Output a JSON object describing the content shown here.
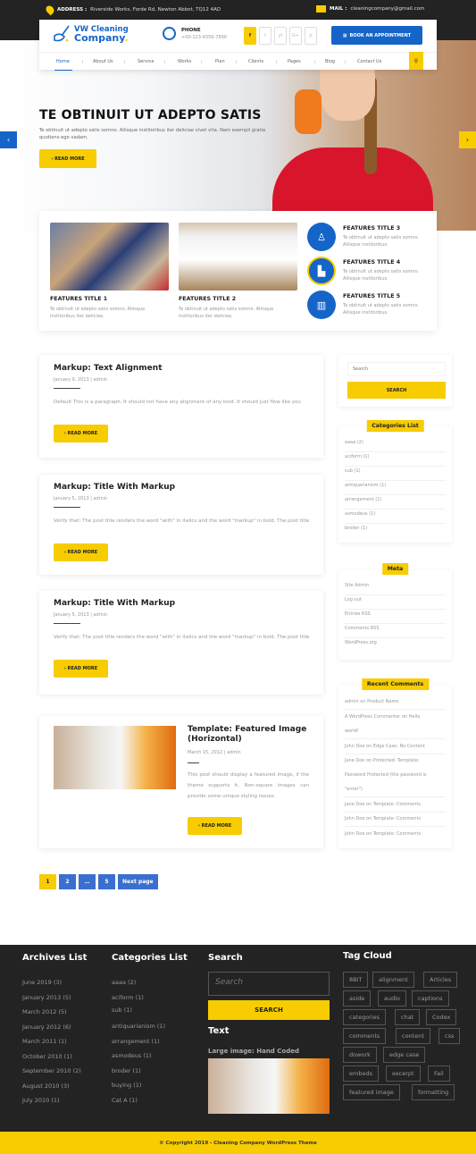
{
  "colors": {
    "primary": "#1565c8",
    "accent": "#f7cc00",
    "dark": "#232323"
  },
  "topbar": {
    "address_label": "ADDRESS :",
    "address": "Riverside Works, Forde Rd, Newton Abbot, TQ12 4AD",
    "mail_label": "MAIL :",
    "mail": "cleaningcompany@gmail.com"
  },
  "header": {
    "logo_line1": "VW Cleaning",
    "logo_line2": "Company",
    "phone_label": "PHONE",
    "phone_number": "+00-123-4356-7890",
    "socials": [
      "f",
      "t",
      "yt",
      "G+",
      "p"
    ],
    "book_label": "BOOK AN APPOINTMENT"
  },
  "nav": {
    "items": [
      "Home",
      "About Us",
      "Service",
      "Works",
      "Plan",
      "Clients",
      "Pages",
      "Blog",
      "Contact Us"
    ],
    "active": "Home",
    "search_icon": "search-icon"
  },
  "hero": {
    "title": "TE OBTINUIT UT ADEPTO SATIS",
    "text": "Te obtinuit ut adepto satis somno. Aliisque institoribus iter deliciae vivet vita. Nam exempli gratia quotiens ego vadam.",
    "button": "READ MORE",
    "prev": "‹",
    "next": "›"
  },
  "features": [
    {
      "title": "FEATURES TITLE 1",
      "text": "Te obtinuit ut adepto satis somno. Aliisque institoribus iter deliciae."
    },
    {
      "title": "FEATURES TITLE 2",
      "text": "Te obtinuit ut adepto satis somno. Aliisque institoribus iter deliciae."
    },
    {
      "title": "FEATURES TITLE 3",
      "text": "Te obtinuit ut adepto satis somno. Aliisque institoribus."
    },
    {
      "title": "FEATURES TITLE 4",
      "text": "Te obtinuit ut adepto satis somno. Aliisque institoribus."
    },
    {
      "title": "FEATURES TITLE 5",
      "text": "Te obtinuit ut adepto satis somno. Aliisque institoribus."
    }
  ],
  "posts": [
    {
      "title": "Markup: Text Alignment",
      "meta": "January 9, 2013  |  admin",
      "excerpt": "Default This is a paragraph. It should not have any alignment of any kind. It should just flow like you",
      "button": "READ MORE"
    },
    {
      "title": "Markup: Title With Markup",
      "meta": "January 5, 2013  |  admin",
      "excerpt": "Verify that: The post title renders the word \"with\" in italics and the word \"markup\" in bold. The post title",
      "button": "READ MORE"
    },
    {
      "title": "Markup: Title With Markup",
      "meta": "January 5, 2013  |  admin",
      "excerpt": "Verify that: The post title renders the word \"with\" in italics and the word \"markup\" in bold. The post title",
      "button": "READ MORE"
    },
    {
      "title": "Template: Featured Image (Horizontal)",
      "meta": "March 15, 2012 | admin",
      "excerpt": "This post should display a featured image, if the theme supports it. Non-square images can provide some unique styling issues.",
      "button": "READ MORE"
    }
  ],
  "pagination": {
    "pages": [
      "1",
      "2",
      "…",
      "5"
    ],
    "current": "1",
    "next": "Next page"
  },
  "sidebar": {
    "search_placeholder": "Search",
    "search_button": "SEARCH",
    "categories_title": "Categories List",
    "categories": [
      "aaaa (2)",
      "aciform (1)",
      "sub (1)",
      "antiquarianism (1)",
      "arrangement (1)",
      "asmodeus (1)",
      "broder (1)"
    ],
    "meta_title": "Meta",
    "meta": [
      "Site Admin",
      "Log out",
      "Entries RSS",
      "Comments RSS",
      "WordPress.org"
    ],
    "recent_title": "Recent Comments",
    "recent": [
      "admin on Product Name",
      "A WordPress Commenter on Hello",
      "world!",
      "John Doe on Edge Case: No Content",
      "Jane Doe on Protected: Template:",
      "Password Protected (the password is",
      "\"enter\")",
      "Jane Doe on Template: Comments",
      "John Doe on Template: Comments",
      "John Doe on Template: Comments"
    ]
  },
  "footer": {
    "archives_title": "Archives List",
    "archives": [
      "June 2019 (3)",
      "January 2013 (5)",
      "March 2012 (5)",
      "January 2012 (6)",
      "March 2011 (1)",
      "October 2010 (1)",
      "September 2010 (2)",
      "August 2010 (3)",
      "July 2010 (1)"
    ],
    "categories_title": "Categories List",
    "categories": [
      "aaaa (2)",
      "aciform (1)",
      "sub (1)",
      "antiquarianism (1)",
      "arrangement (1)",
      "asmodeus (1)",
      "broder (1)",
      "buying (1)",
      "Cat A (1)"
    ],
    "search_title": "Search",
    "search_placeholder": "Search",
    "search_button": "SEARCH",
    "text_title": "Text",
    "image_caption": "Large image: Hand Coded",
    "tags_title": "Tag Cloud",
    "tags": [
      "8BIT",
      "alignment",
      "Articles",
      "aside",
      "audio",
      "captions",
      "categories",
      "chat",
      "Codex",
      "comments",
      "content",
      "css",
      "dowork",
      "edge case",
      "embeds",
      "excerpt",
      "Fail",
      "featured image",
      "formatting"
    ]
  },
  "copyright": "© Copyright 2019 - Cleaning Company WordPress Theme"
}
